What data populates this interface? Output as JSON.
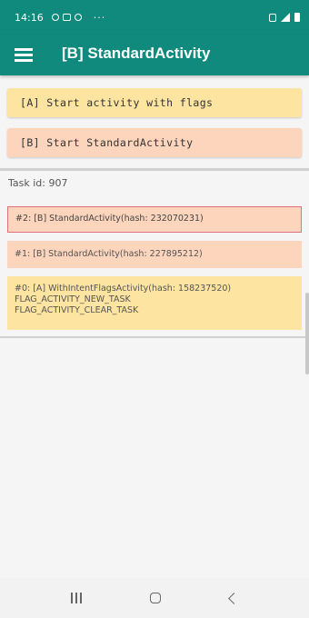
{
  "status_bar": {
    "time": "14:16",
    "more": "···",
    "icons_left": [
      "sync-icon",
      "image-icon",
      "at-icon"
    ],
    "icons_right": [
      "vibrate-icon",
      "signal-icon",
      "battery-icon"
    ]
  },
  "app_bar": {
    "title": "[B] StandardActivity",
    "menu_icon": "hamburger-menu-icon"
  },
  "buttons": {
    "start_with_flags": "[A] Start activity with flags",
    "start_standard": "[B] Start StandardActivity"
  },
  "task": {
    "label": "Task id: 907",
    "entries": [
      {
        "lines": [
          "#2: [B] StandardActivity(hash: 232070231)"
        ]
      },
      {
        "lines": [
          "#1: [B] StandardActivity(hash: 227895212)"
        ]
      },
      {
        "lines": [
          "#0: [A] WithIntentFlagsActivity(hash: 158237520)",
          "FLAG_ACTIVITY_NEW_TASK",
          "FLAG_ACTIVITY_CLEAR_TASK"
        ]
      }
    ]
  },
  "nav_bar": {
    "icons": [
      "recents-icon",
      "home-icon",
      "back-icon"
    ]
  },
  "colors": {
    "primary": "#0f8a7c",
    "yellow_card": "#fde4a1",
    "orange_card": "#fcd5bc",
    "highlight_border": "#e07080"
  }
}
